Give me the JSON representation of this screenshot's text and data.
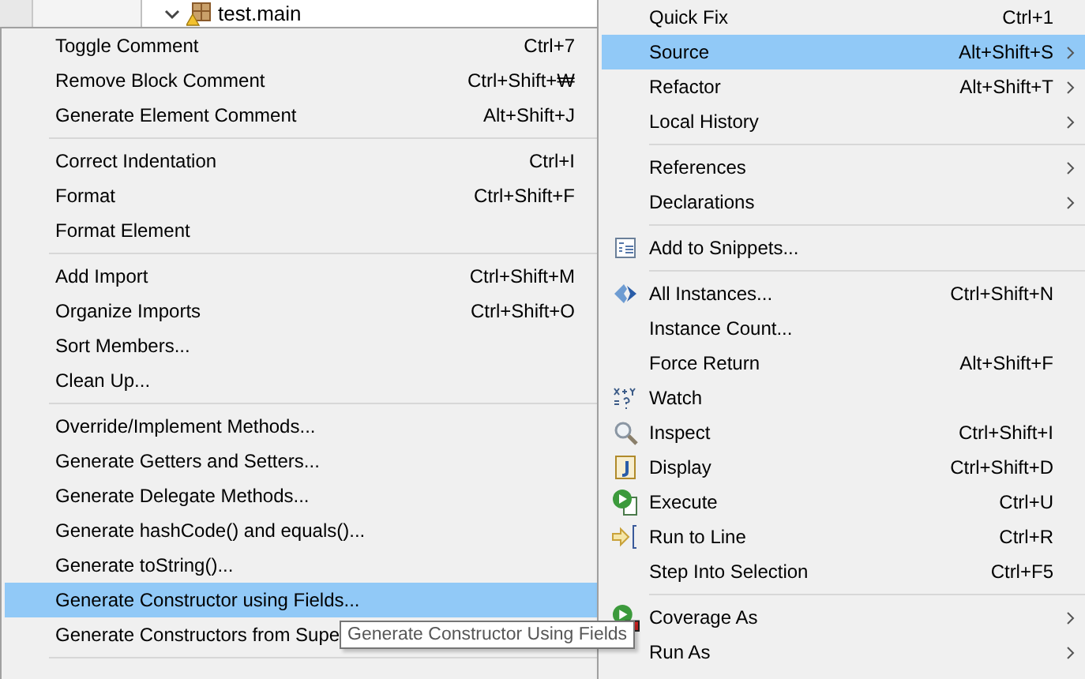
{
  "tree_item": {
    "label": "test.main",
    "expanded": true
  },
  "source_submenu": {
    "items": [
      {
        "kind": "item",
        "label": "Toggle Comment",
        "shortcut": "Ctrl+7",
        "selected": false
      },
      {
        "kind": "item",
        "label": "Remove Block Comment",
        "shortcut": "Ctrl+Shift+₩",
        "selected": false
      },
      {
        "kind": "item",
        "label": "Generate Element Comment",
        "shortcut": "Alt+Shift+J",
        "selected": false
      },
      {
        "kind": "separator"
      },
      {
        "kind": "item",
        "label": "Correct Indentation",
        "shortcut": "Ctrl+I",
        "selected": false
      },
      {
        "kind": "item",
        "label": "Format",
        "shortcut": "Ctrl+Shift+F",
        "selected": false
      },
      {
        "kind": "item",
        "label": "Format Element",
        "selected": false
      },
      {
        "kind": "separator"
      },
      {
        "kind": "item",
        "label": "Add Import",
        "shortcut": "Ctrl+Shift+M",
        "selected": false
      },
      {
        "kind": "item",
        "label": "Organize Imports",
        "shortcut": "Ctrl+Shift+O",
        "selected": false
      },
      {
        "kind": "item",
        "label": "Sort Members...",
        "selected": false
      },
      {
        "kind": "item",
        "label": "Clean Up...",
        "selected": false
      },
      {
        "kind": "separator"
      },
      {
        "kind": "item",
        "label": "Override/Implement Methods...",
        "selected": false
      },
      {
        "kind": "item",
        "label": "Generate Getters and Setters...",
        "selected": false
      },
      {
        "kind": "item",
        "label": "Generate Delegate Methods...",
        "selected": false
      },
      {
        "kind": "item",
        "label": "Generate hashCode() and equals()...",
        "selected": false
      },
      {
        "kind": "item",
        "label": "Generate toString()...",
        "selected": false
      },
      {
        "kind": "item",
        "label": "Generate Constructor using Fields...",
        "selected": true
      },
      {
        "kind": "item",
        "label": "Generate Constructors from Supe",
        "selected": false
      },
      {
        "kind": "separator"
      }
    ]
  },
  "context_menu": {
    "items": [
      {
        "kind": "item",
        "label": "Quick Fix",
        "shortcut": "Ctrl+1",
        "selected": false,
        "has_submenu": false
      },
      {
        "kind": "item",
        "label": "Source",
        "shortcut": "Alt+Shift+S",
        "selected": true,
        "has_submenu": true
      },
      {
        "kind": "item",
        "label": "Refactor",
        "shortcut": "Alt+Shift+T",
        "selected": false,
        "has_submenu": true
      },
      {
        "kind": "item",
        "label": "Local History",
        "selected": false,
        "has_submenu": true
      },
      {
        "kind": "separator"
      },
      {
        "kind": "item",
        "label": "References",
        "selected": false,
        "has_submenu": true
      },
      {
        "kind": "item",
        "label": "Declarations",
        "selected": false,
        "has_submenu": true
      },
      {
        "kind": "separator"
      },
      {
        "kind": "item",
        "label": "Add to Snippets...",
        "selected": false,
        "has_submenu": false
      },
      {
        "kind": "separator"
      },
      {
        "kind": "item",
        "label": "All Instances...",
        "shortcut": "Ctrl+Shift+N",
        "selected": false,
        "has_submenu": false
      },
      {
        "kind": "item",
        "label": "Instance Count...",
        "selected": false,
        "has_submenu": false
      },
      {
        "kind": "item",
        "label": "Force Return",
        "shortcut": "Alt+Shift+F",
        "selected": false,
        "has_submenu": false
      },
      {
        "kind": "item",
        "label": "Watch",
        "selected": false,
        "has_submenu": false
      },
      {
        "kind": "item",
        "label": "Inspect",
        "shortcut": "Ctrl+Shift+I",
        "selected": false,
        "has_submenu": false
      },
      {
        "kind": "item",
        "label": "Display",
        "shortcut": "Ctrl+Shift+D",
        "selected": false,
        "has_submenu": false
      },
      {
        "kind": "item",
        "label": "Execute",
        "shortcut": "Ctrl+U",
        "selected": false,
        "has_submenu": false
      },
      {
        "kind": "item",
        "label": "Run to Line",
        "shortcut": "Ctrl+R",
        "selected": false,
        "has_submenu": false
      },
      {
        "kind": "item",
        "label": "Step Into Selection",
        "shortcut": "Ctrl+F5",
        "selected": false,
        "has_submenu": false
      },
      {
        "kind": "separator"
      },
      {
        "kind": "item",
        "label": "Coverage As",
        "selected": false,
        "has_submenu": true
      },
      {
        "kind": "item",
        "label": "Run As",
        "selected": false,
        "has_submenu": true
      }
    ]
  },
  "tooltip": {
    "text": "Generate Constructor Using Fields"
  }
}
